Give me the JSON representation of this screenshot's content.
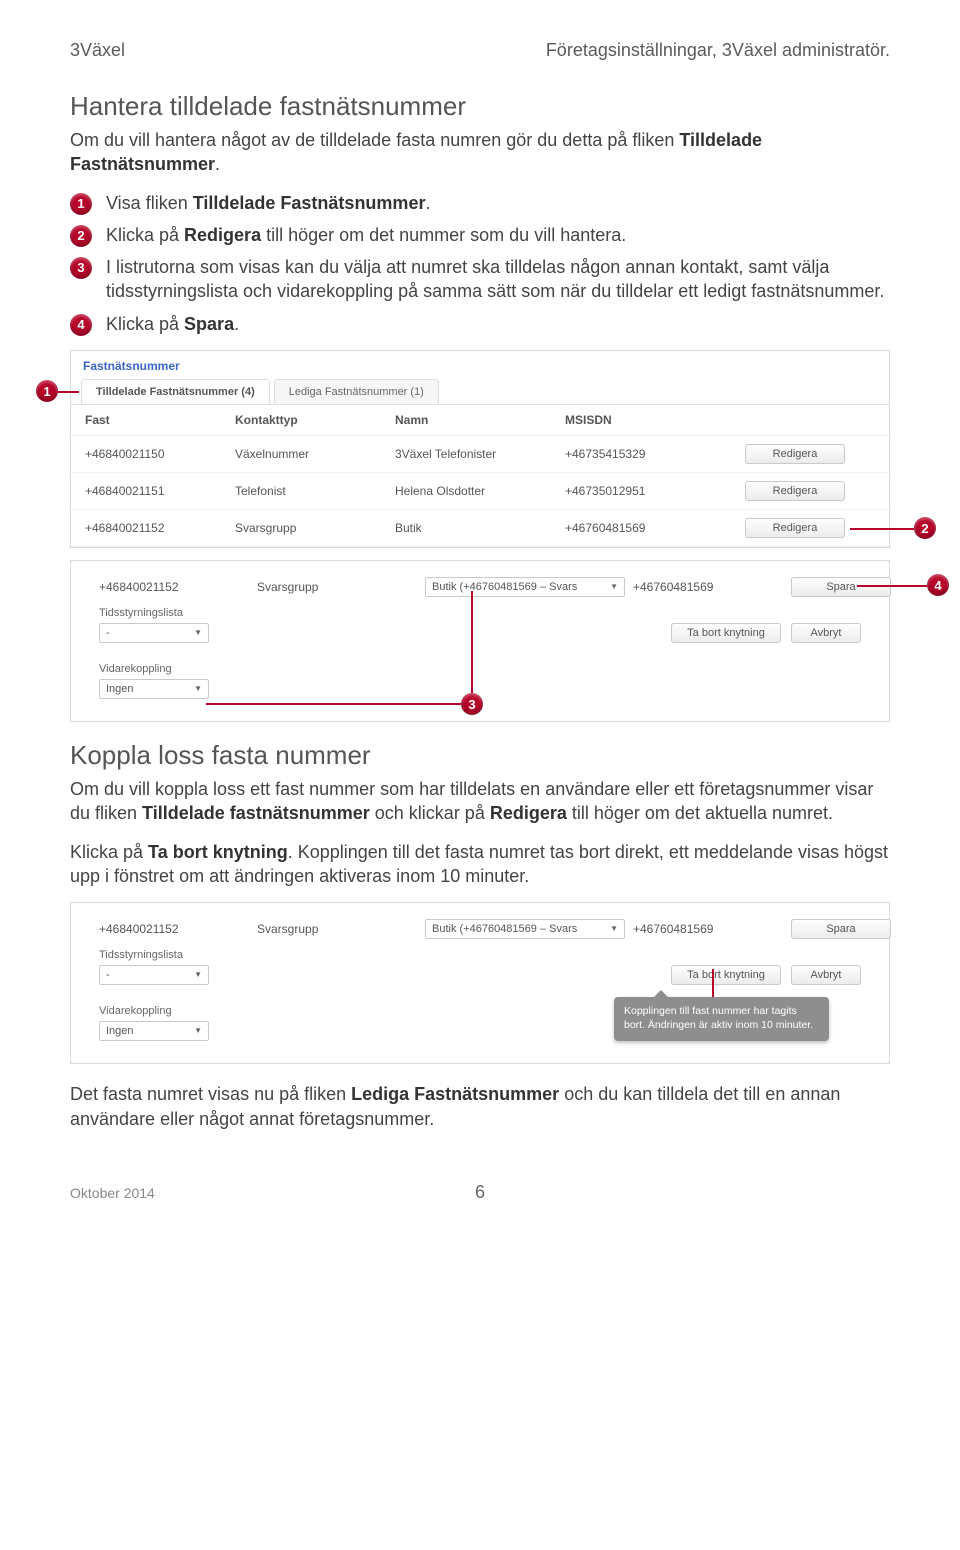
{
  "header": {
    "left": "3Växel",
    "right": "Företagsinställningar, 3Växel administratör."
  },
  "section1": {
    "heading": "Hantera tilldelade fastnätsnummer",
    "intro_pre": "Om du vill hantera något av de tilldelade fasta numren gör du detta på fliken ",
    "intro_bold": "Tilldelade Fastnätsnummer",
    "intro_post": "."
  },
  "steps": {
    "s1_pre": "Visa fliken ",
    "s1_bold": "Tilldelade Fastnätsnummer",
    "s1_post": ".",
    "s2_pre": "Klicka på ",
    "s2_bold": "Redigera",
    "s2_post": " till höger om det nummer som du vill hantera.",
    "s3": "I listrutorna som visas kan du välja att numret ska tilldelas någon annan kontakt, samt välja tidsstyrningslista och vidarekoppling på samma sätt som när du tilldelar ett ledigt fastnätsnummer.",
    "s4_pre": "Klicka på ",
    "s4_bold": "Spara",
    "s4_post": "."
  },
  "callouts": {
    "c1": "1",
    "c2": "2",
    "c3": "3",
    "c4": "4"
  },
  "panel1": {
    "title": "Fastnätsnummer",
    "tab_active": "Tilldelade Fastnätsnummer (4)",
    "tab_inactive": "Lediga Fastnätsnummer (1)",
    "colFast": "Fast",
    "colKontakt": "Kontakttyp",
    "colNamn": "Namn",
    "colMsisdn": "MSISDN",
    "rows": [
      {
        "fast": "+46840021150",
        "typ": "Växelnummer",
        "namn": "3Växel Telefonister",
        "msisdn": "+46735415329"
      },
      {
        "fast": "+46840021151",
        "typ": "Telefonist",
        "namn": "Helena Olsdotter",
        "msisdn": "+46735012951"
      },
      {
        "fast": "+46840021152",
        "typ": "Svarsgrupp",
        "namn": "Butik",
        "msisdn": "+46760481569"
      }
    ],
    "btn_edit": "Redigera"
  },
  "panel2": {
    "rowFast": "+46840021152",
    "rowTyp": "Svarsgrupp",
    "selContact": "Butik (+46760481569 – Svars",
    "rowMsisdn": "+46760481569",
    "btn_save": "Spara",
    "lblTids": "Tidsstyrningslista",
    "selTids": "-",
    "btn_remove": "Ta bort knytning",
    "btn_cancel": "Avbryt",
    "lblVidare": "Vidarekoppling",
    "selVidare": "Ingen"
  },
  "section2": {
    "heading": "Koppla loss fasta nummer",
    "p1a": "Om du vill koppla loss ett fast nummer som har tilldelats en användare eller ett företagsnummer visar du fliken ",
    "p1b": "Tilldelade fastnätsnummer",
    "p1c": " och klickar på ",
    "p1d": "Redigera",
    "p1e": " till höger om det aktuella numret.",
    "p2a": "Klicka på ",
    "p2b": "Ta bort knytning",
    "p2c": ". Kopplingen till det fasta numret tas bort direkt, ett meddelande visas högst upp i fönstret om att ändringen aktiveras inom 10 minuter.",
    "tooltip": "Kopplingen till fast nummer har tagits bort. Ändringen är aktiv inom 10 minuter.",
    "p3a": "Det fasta numret visas nu på fliken ",
    "p3b": "Lediga Fastnätsnummer",
    "p3c": " och du kan tilldela det till en annan användare eller något annat företagsnummer."
  },
  "footer": {
    "date": "Oktober 2014",
    "page": "6"
  }
}
